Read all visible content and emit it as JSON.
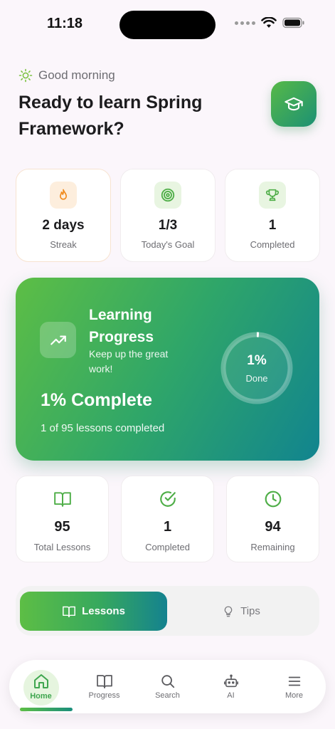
{
  "status_bar": {
    "time": "11:18"
  },
  "header": {
    "greeting": "Good morning",
    "headline": "Ready to learn Spring Framework?"
  },
  "stats": [
    {
      "value": "2 days",
      "label": "Streak",
      "icon": "flame-icon"
    },
    {
      "value": "1/3",
      "label": "Today's Goal",
      "icon": "target-icon"
    },
    {
      "value": "1",
      "label": "Completed",
      "icon": "trophy-icon"
    }
  ],
  "progress_card": {
    "title": "Learning Progress",
    "subtitle": "Keep up the great work!",
    "percent_text": "1% Complete",
    "lessons_text": "1 of 95 lessons completed",
    "ring_percent": "1%",
    "ring_label": "Done",
    "progress_fraction": 0.01
  },
  "summary": [
    {
      "value": "95",
      "label": "Total Lessons",
      "icon": "book-icon"
    },
    {
      "value": "1",
      "label": "Completed",
      "icon": "check-circle-icon"
    },
    {
      "value": "94",
      "label": "Remaining",
      "icon": "clock-icon"
    }
  ],
  "segments": {
    "active": "Lessons",
    "inactive": "Tips"
  },
  "tabbar": [
    {
      "label": "Home",
      "icon": "home-icon",
      "active": true
    },
    {
      "label": "Progress",
      "icon": "book-icon"
    },
    {
      "label": "Search",
      "icon": "search-icon"
    },
    {
      "label": "AI",
      "icon": "robot-icon"
    },
    {
      "label": "More",
      "icon": "menu-icon"
    }
  ],
  "colors": {
    "accent_green": "#57B947",
    "accent_teal": "#11848F",
    "background": "#FBF6FB"
  }
}
